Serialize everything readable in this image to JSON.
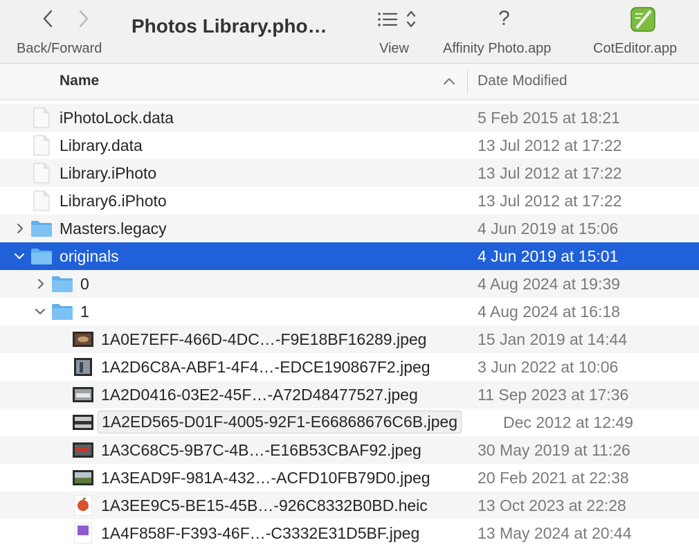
{
  "toolbar": {
    "title": "Photos Library.pho…",
    "back_forward_label": "Back/Forward",
    "view_label": "View",
    "affinity_label": "Affinity Photo.app",
    "affinity_glyph": "?",
    "coteditor_label": "CotEditor.app"
  },
  "columns": {
    "name": "Name",
    "date_modified": "Date Modified"
  },
  "rows": [
    {
      "name": "iPhotoLock.data",
      "date": "5 Feb 2015 at 18:21"
    },
    {
      "name": "Library.data",
      "date": "13 Jul 2012 at 17:22"
    },
    {
      "name": "Library.iPhoto",
      "date": "13 Jul 2012 at 17:22"
    },
    {
      "name": "Library6.iPhoto",
      "date": "13 Jul 2012 at 17:22"
    },
    {
      "name": "Masters.legacy",
      "date": "4 Jun 2019 at 15:06"
    },
    {
      "name": "originals",
      "date": "4 Jun 2019 at 15:01"
    },
    {
      "name": "0",
      "date": "4 Aug 2024 at 19:39"
    },
    {
      "name": "1",
      "date": "4 Aug 2024 at 16:18"
    },
    {
      "name": "1A0E7EFF-466D-4DC…-F9E18BF16289.jpeg",
      "date": "15 Jan 2019 at 14:44"
    },
    {
      "name": "1A2D6C8A-ABF1-4F4…-EDCE190867F2.jpeg",
      "date": "3 Jun 2022 at 10:06"
    },
    {
      "name": "1A2D0416-03E2-45F…-A72D48477527.jpeg",
      "date": "11 Sep 2023 at 17:36"
    },
    {
      "name": "1A2ED565-D01F-4005-92F1-E66868676C6B.jpeg",
      "date": "Dec 2012 at 12:49"
    },
    {
      "name": "1A3C68C5-9B7C-4B…-E16B53CBAF92.jpeg",
      "date": "30 May 2019 at 11:26"
    },
    {
      "name": "1A3EAD9F-981A-432…-ACFD10FB79D0.jpeg",
      "date": "20 Feb 2021 at 22:38"
    },
    {
      "name": "1A3EE9C5-BE15-45B…-926C8332B0BD.heic",
      "date": "13 Oct 2023 at 22:28"
    },
    {
      "name": "1A4F858F-F393-46F…-C3332E31D5BF.jpeg",
      "date": "13 May 2024 at 20:44"
    }
  ],
  "colors": {
    "selection": "#2060d8",
    "folder": "#5fb0ec"
  }
}
